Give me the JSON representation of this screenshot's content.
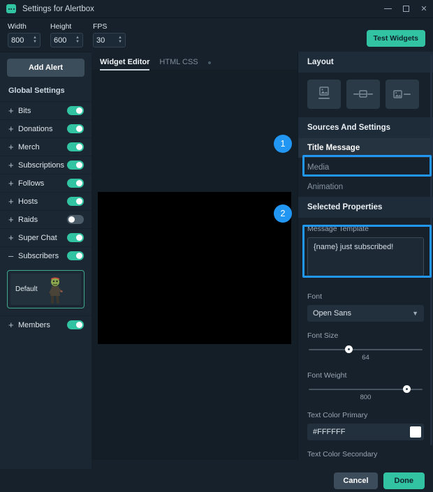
{
  "window": {
    "title": "Settings for Alertbox",
    "app_icon": "chat-bubble-icon",
    "minimize": "–",
    "maximize": "□",
    "close": "✕"
  },
  "toolbar": {
    "fields": [
      {
        "label": "Width",
        "value": "800"
      },
      {
        "label": "Height",
        "value": "600"
      },
      {
        "label": "FPS",
        "value": "30"
      }
    ],
    "test_widgets_label": "Test Widgets",
    "accent_color": "#31c3a2"
  },
  "sidebar": {
    "add_alert_label": "Add Alert",
    "global_settings_label": "Global Settings",
    "items": [
      {
        "label": "Bits",
        "expander": "+",
        "enabled": true
      },
      {
        "label": "Donations",
        "expander": "+",
        "enabled": true
      },
      {
        "label": "Merch",
        "expander": "+",
        "enabled": true
      },
      {
        "label": "Subscriptions",
        "expander": "+",
        "enabled": true
      },
      {
        "label": "Follows",
        "expander": "+",
        "enabled": true
      },
      {
        "label": "Hosts",
        "expander": "+",
        "enabled": true
      },
      {
        "label": "Raids",
        "expander": "+",
        "enabled": false
      },
      {
        "label": "Super Chat",
        "expander": "+",
        "enabled": true
      },
      {
        "label": "Subscribers",
        "expander": "–",
        "enabled": true
      }
    ],
    "variation": {
      "label": "Default"
    },
    "members": {
      "label": "Members",
      "expander": "+",
      "enabled": true
    }
  },
  "center": {
    "tabs": [
      {
        "label": "Widget Editor",
        "active": true
      },
      {
        "label": "HTML CSS",
        "active": false
      }
    ]
  },
  "right_panel": {
    "layout": {
      "title": "Layout",
      "options": [
        {
          "name": "layout-image-above-text-icon"
        },
        {
          "name": "layout-banner-icon"
        },
        {
          "name": "layout-image-beside-text-icon"
        }
      ]
    },
    "sources": {
      "title": "Sources And Settings",
      "items": [
        {
          "label": "Title Message",
          "selected": true
        },
        {
          "label": "Media",
          "selected": false
        },
        {
          "label": "Animation",
          "selected": false
        }
      ]
    },
    "properties": {
      "title": "Selected Properties",
      "message_template": {
        "label": "Message Template",
        "value": "{name} just subscribed!"
      },
      "font": {
        "label": "Font",
        "value": "Open Sans"
      },
      "font_size": {
        "label": "Font Size",
        "value": "64",
        "percent": 35
      },
      "font_weight": {
        "label": "Font Weight",
        "value": "800",
        "percent": 86
      },
      "text_color_primary": {
        "label": "Text Color Primary",
        "value": "#FFFFFF",
        "swatch": "#FFFFFF"
      },
      "text_color_secondary": {
        "label": "Text Color Secondary"
      }
    }
  },
  "footer": {
    "cancel_label": "Cancel",
    "done_label": "Done"
  },
  "annotations": {
    "badge_1": "1",
    "badge_2": "2",
    "highlight_color": "#2196f3"
  }
}
